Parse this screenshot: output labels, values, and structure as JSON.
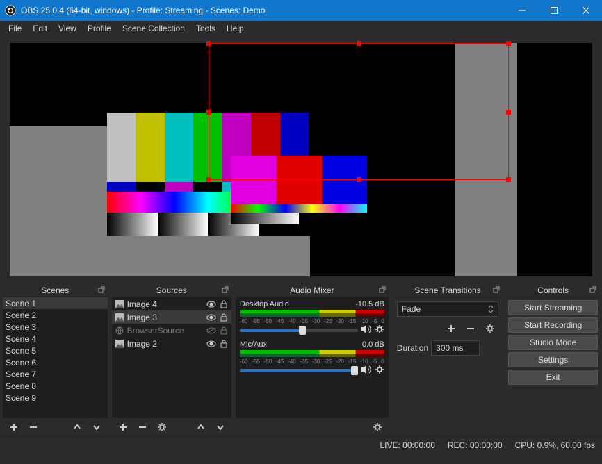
{
  "window": {
    "title": "OBS 25.0.4 (64-bit, windows) - Profile: Streaming - Scenes: Demo"
  },
  "menu": {
    "file": "File",
    "edit": "Edit",
    "view": "View",
    "profile": "Profile",
    "scene_collection": "Scene Collection",
    "tools": "Tools",
    "help": "Help"
  },
  "docks": {
    "scenes": "Scenes",
    "sources": "Sources",
    "mixer": "Audio Mixer",
    "transitions": "Scene Transitions",
    "controls": "Controls"
  },
  "scenes": [
    "Scene 1",
    "Scene 2",
    "Scene 3",
    "Scene 4",
    "Scene 5",
    "Scene 6",
    "Scene 7",
    "Scene 8",
    "Scene 9"
  ],
  "sources": [
    {
      "label": "Image 4",
      "visible": true,
      "locked": false,
      "icon": "image"
    },
    {
      "label": "Image 3",
      "visible": true,
      "locked": false,
      "icon": "image",
      "selected": true
    },
    {
      "label": "BrowserSource",
      "visible": false,
      "locked": false,
      "icon": "globe",
      "disabled": true
    },
    {
      "label": "Image 2",
      "visible": true,
      "locked": false,
      "icon": "image"
    }
  ],
  "mixer": {
    "ch0": {
      "name": "Desktop Audio",
      "db": "-10.5 dB",
      "slider": 53
    },
    "ch1": {
      "name": "Mic/Aux",
      "db": "0.0 dB",
      "slider": 100
    },
    "ticks": [
      "-60",
      "-55",
      "-50",
      "-45",
      "-40",
      "-35",
      "-30",
      "-25",
      "-20",
      "-15",
      "-10",
      "-5",
      "0"
    ]
  },
  "transitions": {
    "type": "Fade",
    "duration_label": "Duration",
    "duration": "300 ms"
  },
  "controls": {
    "start_streaming": "Start Streaming",
    "start_recording": "Start Recording",
    "studio_mode": "Studio Mode",
    "settings": "Settings",
    "exit": "Exit"
  },
  "status": {
    "live": "LIVE: 00:00:00",
    "rec": "REC: 00:00:00",
    "cpu": "CPU: 0.9%, 60.00 fps"
  }
}
